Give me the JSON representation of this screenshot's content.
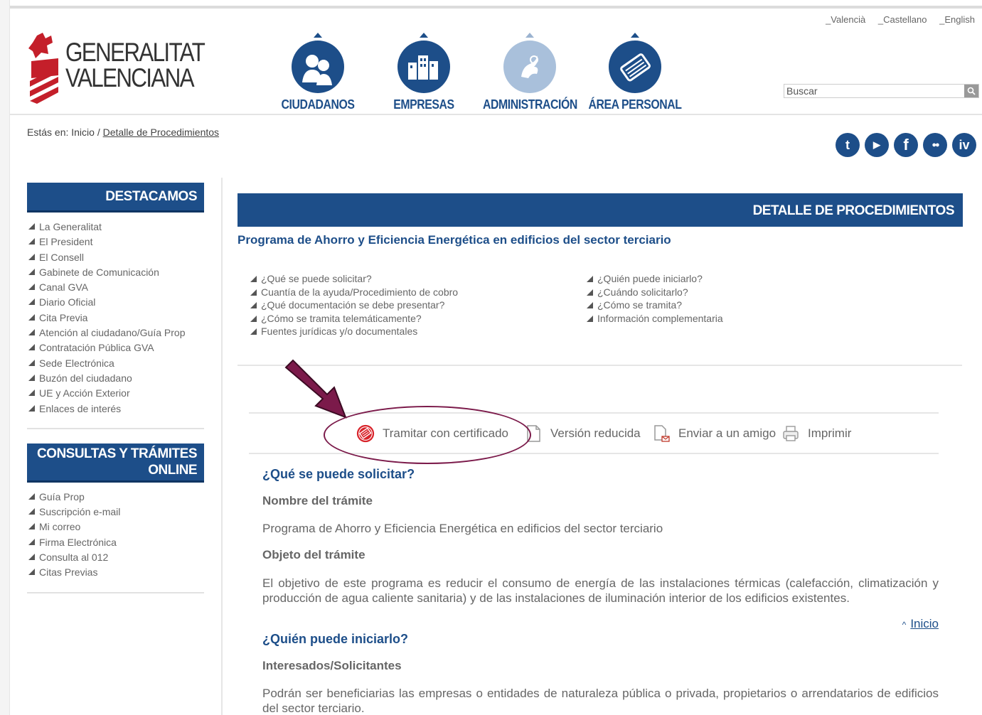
{
  "languages": [
    "_Valencià",
    "_Castellano",
    "_English"
  ],
  "logo": {
    "line1": "GENERALITAT",
    "line2": "VALENCIANA"
  },
  "nav": [
    {
      "label": "CIUDADANOS",
      "icon": "people-icon"
    },
    {
      "label": "EMPRESAS",
      "icon": "buildings-icon"
    },
    {
      "label": "ADMINISTRACIÓN",
      "icon": "administration-icon"
    },
    {
      "label": "ÁREA PERSONAL",
      "icon": "personal-area-icon"
    }
  ],
  "search": {
    "placeholder": "Buscar"
  },
  "breadcrumb": {
    "prefix": "Estás en: Inicio /",
    "current": "Detalle de Procedimientos"
  },
  "social": [
    {
      "icon": "twitter-icon",
      "glyph": "t"
    },
    {
      "icon": "youtube-icon",
      "glyph": "▶"
    },
    {
      "icon": "facebook-icon",
      "glyph": "f"
    },
    {
      "icon": "flickr-icon",
      "glyph": "●●"
    },
    {
      "icon": "iv-icon",
      "glyph": "iv"
    }
  ],
  "sidebar": {
    "destacamos_title": "DESTACAMOS",
    "destacamos": [
      "La Generalitat",
      "El President",
      "El Consell",
      "Gabinete de Comunicación",
      "Canal GVA",
      "Diario Oficial",
      "Cita Previa",
      "Atención al ciudadano/Guía Prop",
      "Contratación Pública GVA",
      "Sede Electrónica",
      "Buzón del ciudadano",
      "UE y Acción Exterior",
      "Enlaces de interés"
    ],
    "consultas_title_1": "CONSULTAS Y TRÁMITES",
    "consultas_title_2": "ONLINE",
    "consultas": [
      "Guía Prop",
      "Suscripción e-mail",
      "Mi correo",
      "Firma Electrónica",
      "Consulta al 012",
      "Citas Previas"
    ]
  },
  "main": {
    "bar_title": "DETALLE DE PROCEDIMIENTOS",
    "procedure_title": "Programa de Ahorro y Eficiencia Energética en edificios del sector terciario",
    "anchors_left": [
      "¿Qué se puede solicitar?",
      "Cuantía de la ayuda/Procedimiento de cobro",
      "¿Qué documentación se debe presentar?",
      "¿Cómo se tramita telemáticamente?",
      "Fuentes jurídicas y/o documentales"
    ],
    "anchors_right": [
      "¿Quién puede iniciarlo?",
      "¿Cuándo solicitarlo?",
      "¿Cómo se tramita?",
      "Información complementaria"
    ],
    "toolbar": {
      "tramitar": "Tramitar con certificado",
      "version": "Versión reducida",
      "enviar": "Enviar a un amigo",
      "imprimir": "Imprimir"
    },
    "sections": {
      "q1_title": "¿Qué se puede solicitar?",
      "nombre_label": "Nombre del trámite",
      "nombre_value": "Programa de Ahorro y Eficiencia Energética en edificios del sector terciario",
      "objeto_label": "Objeto del trámite",
      "objeto_value": "El objetivo de este programa es reducir el consumo de energía de las instalaciones térmicas (calefacción, climatización y producción de agua caliente sanitaria) y de las instalaciones de iluminación interior de los edificios existentes.",
      "inicio_link": "Inicio",
      "q2_title": "¿Quién puede iniciarlo?",
      "interesados_label": "Interesados/Solicitantes",
      "interesados_value": "Podrán ser beneficiarias las empresas o entidades de naturaleza pública o privada, propietarios o arrendatarios de edificios del sector terciario."
    }
  },
  "colors": {
    "brand": "#1d4e89",
    "annotation": "#7b1a4a"
  }
}
